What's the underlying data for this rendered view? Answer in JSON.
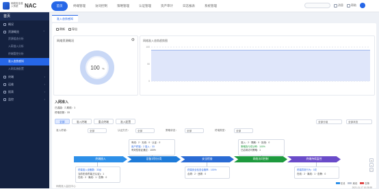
{
  "header": {
    "brand_small": "网络安全准入系统",
    "brand": "NAC",
    "nav": [
      "首页",
      "终端管理",
      "访问控制",
      "策略管理",
      "认证管理",
      "资产审计",
      "日志报表",
      "系统管理"
    ],
    "badges": [
      "消息",
      "帮助"
    ]
  },
  "sidebar": {
    "title": "首页",
    "items": [
      {
        "label": "概况",
        "has_children": false
      },
      {
        "label": "资源概览",
        "has_children": true
      }
    ],
    "subitems": [
      "资源组态分析",
      "入网准入分析",
      "终端管控分析",
      "准入态势感知",
      "入网实施配置"
    ],
    "active_index": 3,
    "more_items": [
      "终端",
      "运维",
      "报表",
      "监控"
    ]
  },
  "tabs": [
    "准入态势感知"
  ],
  "toolbar": {
    "refresh": "刷新",
    "export": "导出"
  },
  "left_panel": {
    "title": "网络资源概况",
    "gauge_value": "100",
    "gauge_unit": "%",
    "gauge_percent": 100
  },
  "right_panel": {
    "title": "网络准入态势趋势图"
  },
  "chart_data": {
    "type": "area",
    "ylim": [
      0,
      100
    ],
    "yticks": [
      "100",
      "50",
      "0"
    ],
    "series": [
      {
        "values": [
          91,
          91,
          91,
          91,
          91,
          91,
          91,
          91,
          91,
          91,
          91,
          91
        ]
      }
    ]
  },
  "info": {
    "name": "入网准入",
    "line1": "已连接：2 离线：1",
    "line2": "终端总数：33"
  },
  "filter_tabs": [
    "全部",
    "准入终端",
    "重点终端",
    "准入配置"
  ],
  "filters": {
    "f1_label": "准入终端：",
    "f1_value": "全部",
    "f2_label": "认证方式：",
    "f2_value": "全部",
    "f3_label": "策略状态：",
    "f3_value": "全部",
    "f4_label": "终端类型：",
    "f4_value": "全部"
  },
  "top_right_selects": [
    "全部分组",
    "全部状态"
  ],
  "stages": [
    {
      "label": "终端接入",
      "color": "#2d8fe8"
    },
    {
      "label": "设备识别分类",
      "color": "#1e7bd9"
    },
    {
      "label": "安全检查",
      "color": "#2a6bd4"
    },
    {
      "label": "网络访问控制",
      "color": "#1e9a3e"
    },
    {
      "label": "终端持续监控",
      "color": "#6a4bc9"
    }
  ],
  "flow_boxes_top": [
    {
      "l1": "有线：2 · 无线：0 · 认证：0",
      "l2": "用户终端：2 准入：33",
      "l3": "有效性验证通过：100%"
    },
    {
      "l1": "准入：2 · 隔离：0 · 拒绝：0",
      "l2": "策略执行成功率：100%",
      "l3": "已启用访问策略：1"
    }
  ],
  "flow_boxes_bottom": [
    {
      "l1": "终端准入设备数：33台",
      "l2": "当前在线终端(已认证)：1",
      "l3": "在线：2 · 离线：1 · 告警：0"
    },
    {
      "l1": "终端安全检查合格率：100%",
      "l2": "合规：2 · 违规：0"
    },
    {
      "l1": "终端异常行为：0次",
      "l2": "在线：2 · 离线：1 · 告警：0"
    }
  ],
  "bottom": {
    "text": "网络准入监控中心",
    "legend": [
      "在线",
      "离线",
      "告警"
    ],
    "time": "2021-11-17 10:26:55"
  }
}
